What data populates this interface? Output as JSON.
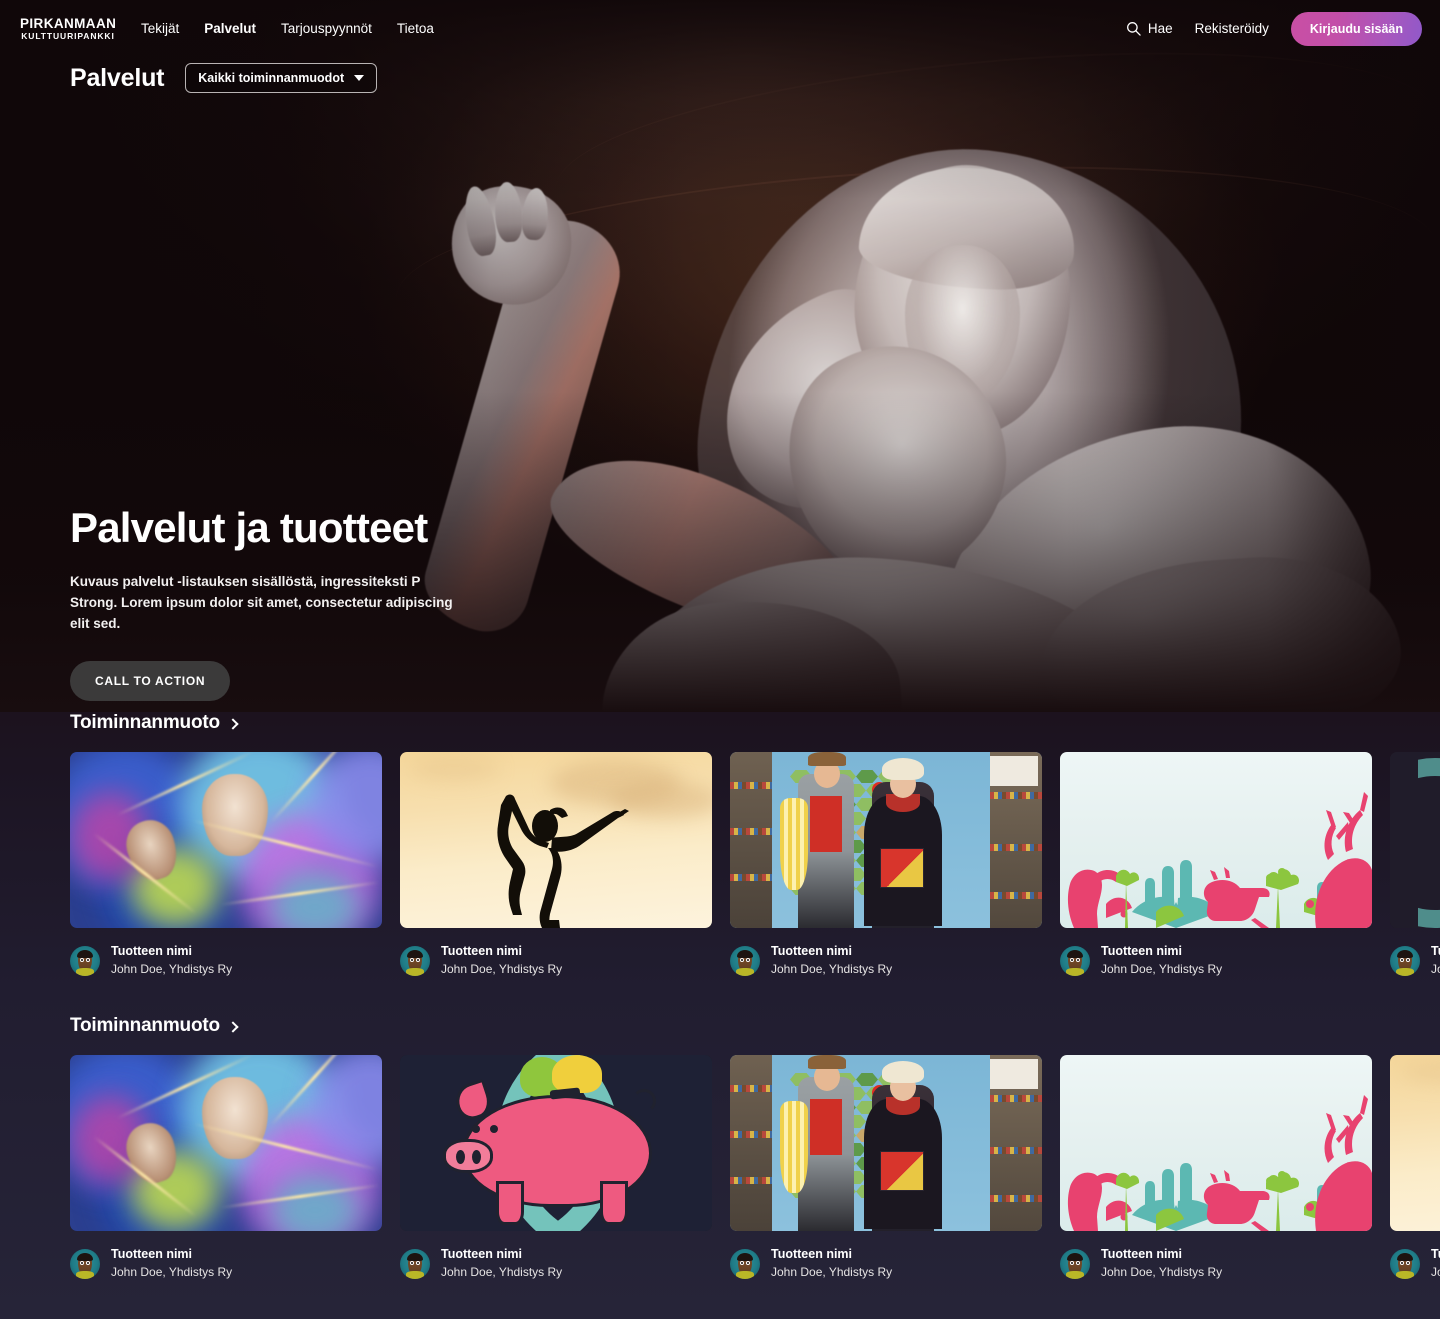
{
  "brand": {
    "line1": "PIRKANMAAN",
    "line2": "KULTTUURIPANKKI"
  },
  "nav": {
    "items": [
      {
        "label": "Tekijät",
        "active": false
      },
      {
        "label": "Palvelut",
        "active": true
      },
      {
        "label": "Tarjouspyynnöt",
        "active": false
      },
      {
        "label": "Tietoa",
        "active": false
      }
    ],
    "search_label": "Hae",
    "register_label": "Rekisteröidy",
    "login_label": "Kirjaudu sisään",
    "login_gradient_from": "#c94fa4",
    "login_gradient_to": "#9059c9"
  },
  "subheader": {
    "page_title": "Palvelut",
    "filter_value": "Kaikki toiminnanmuodot"
  },
  "hero": {
    "heading": "Palvelut ja tuotteet",
    "description": "Kuvaus palvelut -listauksen sisällöstä, ingressiteksti P Strong. Lorem ipsum dolor sit amet, consectetur adipiscing elit sed.",
    "cta_label": "CALL TO ACTION"
  },
  "sections": [
    {
      "heading": "Toiminnanmuoto",
      "cards": [
        {
          "title": "Tuotteen nimi",
          "author": "John Doe, Yhdistys Ry",
          "art": "neon"
        },
        {
          "title": "Tuotteen nimi",
          "author": "John Doe, Yhdistys Ry",
          "art": "dancer"
        },
        {
          "title": "Tuotteen nimi",
          "author": "John Doe, Yhdistys Ry",
          "art": "game"
        },
        {
          "title": "Tuotteen nimi",
          "author": "John Doe, Yhdistys Ry",
          "art": "nature"
        },
        {
          "title": "Tuotteen nimi",
          "author": "John Doe, Yhdistys Ry",
          "art": "circle"
        }
      ]
    },
    {
      "heading": "Toiminnanmuoto",
      "cards": [
        {
          "title": "Tuotteen nimi",
          "author": "John Doe, Yhdistys Ry",
          "art": "neon"
        },
        {
          "title": "Tuotteen nimi",
          "author": "John Doe, Yhdistys Ry",
          "art": "pig"
        },
        {
          "title": "Tuotteen nimi",
          "author": "John Doe, Yhdistys Ry",
          "art": "game"
        },
        {
          "title": "Tuotteen nimi",
          "author": "John Doe, Yhdistys Ry",
          "art": "nature"
        },
        {
          "title": "Tuotteen nimi",
          "author": "John Doe, Yhdistys Ry",
          "art": "dancer"
        }
      ]
    }
  ]
}
